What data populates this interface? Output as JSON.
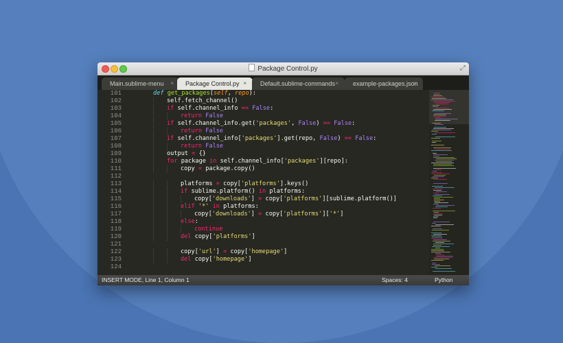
{
  "window": {
    "title": "Package Control.py"
  },
  "tabs": [
    {
      "label": "Main.sublime-menu",
      "active": false
    },
    {
      "label": "Package Control.py",
      "active": true
    },
    {
      "label": "Default.sublime-commands",
      "active": false
    },
    {
      "label": "example-packages.json",
      "active": false
    }
  ],
  "tab_close_glyph": "×",
  "status": {
    "mode": "INSERT MODE, Line 1, Column 1",
    "spaces": "Spaces: 4",
    "syntax": "Python"
  },
  "colors": {
    "background": "#272822",
    "keyword": "#f92672",
    "function": "#a6e22e",
    "string": "#e6db74",
    "constant": "#ae81ff",
    "storage": "#66d9ef",
    "parameter": "#fd971f",
    "text": "#f8f8f2"
  },
  "code_lines": [
    {
      "num": "101",
      "indent": 1,
      "tokens": [
        [
          "def ",
          "storage-italic"
        ],
        [
          "get_packages",
          "function"
        ],
        [
          "(",
          "text"
        ],
        [
          "self",
          "param"
        ],
        [
          ", ",
          "text"
        ],
        [
          "repo",
          "param"
        ],
        [
          "):",
          "text"
        ]
      ]
    },
    {
      "num": "102",
      "indent": 2,
      "tokens": [
        [
          "self.fetch_channel()",
          "text"
        ]
      ]
    },
    {
      "num": "103",
      "indent": 2,
      "tokens": [
        [
          "if ",
          "keyword"
        ],
        [
          "self.channel_info ",
          "text"
        ],
        [
          "== ",
          "keyword"
        ],
        [
          "False",
          "constant"
        ],
        [
          ":",
          "text"
        ]
      ]
    },
    {
      "num": "104",
      "indent": 3,
      "tokens": [
        [
          "return ",
          "keyword"
        ],
        [
          "False",
          "constant"
        ]
      ]
    },
    {
      "num": "105",
      "indent": 2,
      "tokens": [
        [
          "if ",
          "keyword"
        ],
        [
          "self.channel_info.get(",
          "text"
        ],
        [
          "'packages'",
          "string"
        ],
        [
          ", ",
          "text"
        ],
        [
          "False",
          "constant"
        ],
        [
          ") ",
          "text"
        ],
        [
          "== ",
          "keyword"
        ],
        [
          "False",
          "constant"
        ],
        [
          ":",
          "text"
        ]
      ]
    },
    {
      "num": "106",
      "indent": 3,
      "tokens": [
        [
          "return ",
          "keyword"
        ],
        [
          "False",
          "constant"
        ]
      ]
    },
    {
      "num": "107",
      "indent": 2,
      "tokens": [
        [
          "if ",
          "keyword"
        ],
        [
          "self.channel_info[",
          "text"
        ],
        [
          "'packages'",
          "string"
        ],
        [
          "].get(repo, ",
          "text"
        ],
        [
          "False",
          "constant"
        ],
        [
          ") ",
          "text"
        ],
        [
          "== ",
          "keyword"
        ],
        [
          "False",
          "constant"
        ],
        [
          ":",
          "text"
        ]
      ]
    },
    {
      "num": "108",
      "indent": 3,
      "tokens": [
        [
          "return ",
          "keyword"
        ],
        [
          "False",
          "constant"
        ]
      ]
    },
    {
      "num": "109",
      "indent": 2,
      "tokens": [
        [
          "output ",
          "text"
        ],
        [
          "= ",
          "keyword"
        ],
        [
          "{}",
          "text"
        ]
      ]
    },
    {
      "num": "110",
      "indent": 2,
      "tokens": [
        [
          "for ",
          "keyword"
        ],
        [
          "package ",
          "text"
        ],
        [
          "in ",
          "keyword"
        ],
        [
          "self.channel_info[",
          "text"
        ],
        [
          "'packages'",
          "string"
        ],
        [
          "][repo]:",
          "text"
        ]
      ]
    },
    {
      "num": "111",
      "indent": 3,
      "tokens": [
        [
          "copy ",
          "text"
        ],
        [
          "= ",
          "keyword"
        ],
        [
          "package.copy()",
          "text"
        ]
      ]
    },
    {
      "num": "112",
      "indent": 0,
      "tokens": []
    },
    {
      "num": "113",
      "indent": 3,
      "tokens": [
        [
          "platforms ",
          "text"
        ],
        [
          "= ",
          "keyword"
        ],
        [
          "copy[",
          "text"
        ],
        [
          "'platforms'",
          "string"
        ],
        [
          "].keys()",
          "text"
        ]
      ]
    },
    {
      "num": "114",
      "indent": 3,
      "tokens": [
        [
          "if ",
          "keyword"
        ],
        [
          "sublime.platform() ",
          "text"
        ],
        [
          "in ",
          "keyword"
        ],
        [
          "platforms:",
          "text"
        ]
      ]
    },
    {
      "num": "115",
      "indent": 4,
      "tokens": [
        [
          "copy[",
          "text"
        ],
        [
          "'downloads'",
          "string"
        ],
        [
          "] ",
          "text"
        ],
        [
          "= ",
          "keyword"
        ],
        [
          "copy[",
          "text"
        ],
        [
          "'platforms'",
          "string"
        ],
        [
          "][sublime.platform()]",
          "text"
        ]
      ]
    },
    {
      "num": "116",
      "indent": 3,
      "tokens": [
        [
          "elif ",
          "keyword"
        ],
        [
          "'*' ",
          "string"
        ],
        [
          "in ",
          "keyword"
        ],
        [
          "platforms:",
          "text"
        ]
      ]
    },
    {
      "num": "117",
      "indent": 4,
      "tokens": [
        [
          "copy[",
          "text"
        ],
        [
          "'downloads'",
          "string"
        ],
        [
          "] ",
          "text"
        ],
        [
          "= ",
          "keyword"
        ],
        [
          "copy[",
          "text"
        ],
        [
          "'platforms'",
          "string"
        ],
        [
          "][",
          "text"
        ],
        [
          "'*'",
          "string"
        ],
        [
          "]",
          "text"
        ]
      ]
    },
    {
      "num": "118",
      "indent": 3,
      "tokens": [
        [
          "else",
          "keyword"
        ],
        [
          ":",
          "text"
        ]
      ]
    },
    {
      "num": "119",
      "indent": 4,
      "tokens": [
        [
          "continue",
          "keyword"
        ]
      ]
    },
    {
      "num": "120",
      "indent": 3,
      "tokens": [
        [
          "del ",
          "keyword"
        ],
        [
          "copy[",
          "text"
        ],
        [
          "'platforms'",
          "string"
        ],
        [
          "]",
          "text"
        ]
      ]
    },
    {
      "num": "121",
      "indent": 0,
      "tokens": []
    },
    {
      "num": "122",
      "indent": 3,
      "tokens": [
        [
          "copy[",
          "text"
        ],
        [
          "'url'",
          "string"
        ],
        [
          "] ",
          "text"
        ],
        [
          "= ",
          "keyword"
        ],
        [
          "copy[",
          "text"
        ],
        [
          "'homepage'",
          "string"
        ],
        [
          "]",
          "text"
        ]
      ]
    },
    {
      "num": "123",
      "indent": 3,
      "tokens": [
        [
          "del ",
          "keyword"
        ],
        [
          "copy[",
          "text"
        ],
        [
          "'homepage'",
          "string"
        ],
        [
          "]",
          "text"
        ]
      ]
    },
    {
      "num": "124",
      "indent": 0,
      "tokens": []
    }
  ]
}
